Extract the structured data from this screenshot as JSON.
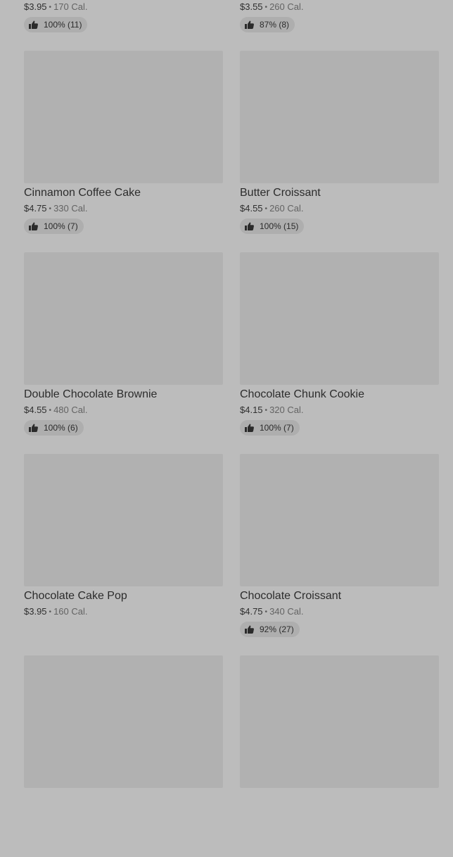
{
  "items": [
    {
      "name": "",
      "price": "$3.95",
      "calories": "170 Cal.",
      "rating": "100% (11)"
    },
    {
      "name": "",
      "price": "$3.55",
      "calories": "260 Cal.",
      "rating": "87% (8)"
    },
    {
      "name": "Cinnamon Coffee Cake",
      "price": "$4.75",
      "calories": "330 Cal.",
      "rating": "100% (7)"
    },
    {
      "name": "Butter Croissant",
      "price": "$4.55",
      "calories": "260 Cal.",
      "rating": "100% (15)"
    },
    {
      "name": "Double Chocolate Brownie",
      "price": "$4.55",
      "calories": "480 Cal.",
      "rating": "100% (6)"
    },
    {
      "name": "Chocolate Chunk Cookie",
      "price": "$4.15",
      "calories": "320 Cal.",
      "rating": "100% (7)"
    },
    {
      "name": "Chocolate Cake Pop",
      "price": "$3.95",
      "calories": "160 Cal.",
      "rating": null
    },
    {
      "name": "Chocolate Croissant",
      "price": "$4.75",
      "calories": "340 Cal.",
      "rating": "92% (27)"
    },
    {
      "name": "",
      "price": "",
      "calories": "",
      "rating": null
    },
    {
      "name": "",
      "price": "",
      "calories": "",
      "rating": null
    }
  ],
  "icons": {
    "rating": "thumbs-up-icon",
    "separator": "•"
  },
  "colors": {
    "background": "#bcbcbc",
    "image_placeholder": "#b1b1b1",
    "rating_pill": "#aeaeae"
  }
}
